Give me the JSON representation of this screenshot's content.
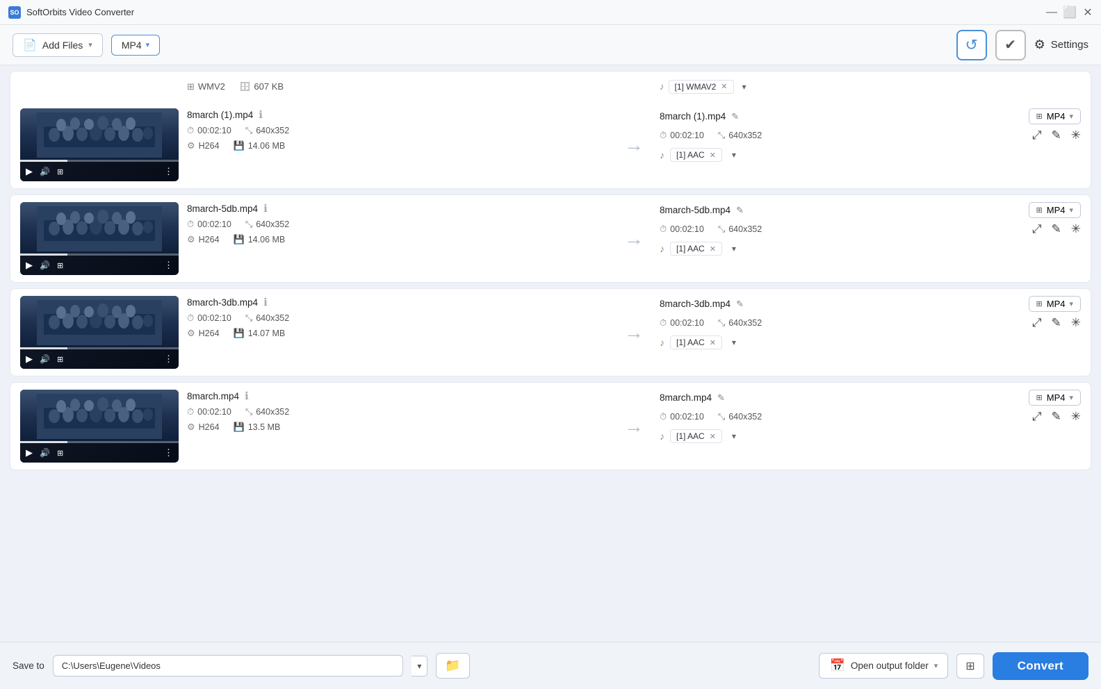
{
  "app": {
    "title": "SoftOrbits Video Converter",
    "icon": "SO"
  },
  "titlebar": {
    "minimize": "—",
    "maximize": "⬜",
    "close": "✕"
  },
  "toolbar": {
    "add_files_label": "Add Files",
    "format_label": "MP4",
    "reset_icon": "↺",
    "checkmark_icon": "✔",
    "settings_label": "Settings"
  },
  "files": [
    {
      "id": "file-wmv2",
      "name_left": "WMV2",
      "size_left": "607 KB",
      "codec_left": "WMAV2",
      "is_scrolled_top": true
    },
    {
      "id": "file-8march1",
      "name_left": "8march (1).mp4",
      "duration_left": "00:02:10",
      "resolution_left": "640x352",
      "codec_left": "H264",
      "size_left": "14.06 MB",
      "name_right": "8march (1).mp4",
      "duration_right": "00:02:10",
      "resolution_right": "640x352",
      "format_right": "MP4",
      "audio_right": "[1] AAC"
    },
    {
      "id": "file-8march5db",
      "name_left": "8march-5db.mp4",
      "duration_left": "00:02:10",
      "resolution_left": "640x352",
      "codec_left": "H264",
      "size_left": "14.06 MB",
      "name_right": "8march-5db.mp4",
      "duration_right": "00:02:10",
      "resolution_right": "640x352",
      "format_right": "MP4",
      "audio_right": "[1] AAC"
    },
    {
      "id": "file-8march3db",
      "name_left": "8march-3db.mp4",
      "duration_left": "00:02:10",
      "resolution_left": "640x352",
      "codec_left": "H264",
      "size_left": "14.07 MB",
      "name_right": "8march-3db.mp4",
      "duration_right": "00:02:10",
      "resolution_right": "640x352",
      "format_right": "MP4",
      "audio_right": "[1] AAC"
    },
    {
      "id": "file-8march",
      "name_left": "8march.mp4",
      "duration_left": "00:02:10",
      "resolution_left": "640x352",
      "codec_left": "H264",
      "size_left": "13.5 MB",
      "name_right": "8march.mp4",
      "duration_right": "00:02:10",
      "resolution_right": "640x352",
      "format_right": "MP4",
      "audio_right": "[1] AAC"
    }
  ],
  "footer": {
    "save_to_label": "Save to",
    "save_path": "C:\\Users\\Eugene\\Videos",
    "open_folder_label": "Open output folder",
    "convert_label": "Convert"
  }
}
